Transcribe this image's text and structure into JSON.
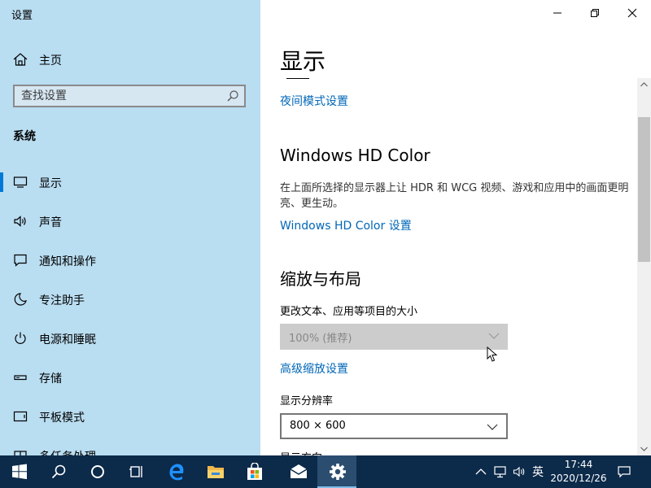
{
  "sidebar": {
    "app_title": "设置",
    "home_label": "主页",
    "search_placeholder": "查找设置",
    "section_label": "系统",
    "items": [
      {
        "label": "显示",
        "icon": "monitor-icon",
        "selected": true
      },
      {
        "label": "声音",
        "icon": "speaker-icon"
      },
      {
        "label": "通知和操作",
        "icon": "notification-icon"
      },
      {
        "label": "专注助手",
        "icon": "moon-icon"
      },
      {
        "label": "电源和睡眠",
        "icon": "power-icon"
      },
      {
        "label": "存储",
        "icon": "storage-icon"
      },
      {
        "label": "平板模式",
        "icon": "tablet-icon"
      },
      {
        "label": "多任务处理",
        "icon": "multitask-icon"
      }
    ]
  },
  "main": {
    "title": "显示",
    "night_light_link": "夜间模式设置",
    "hdr": {
      "heading": "Windows HD Color",
      "description": "在上面所选择的显示器上让 HDR 和 WCG 视频、游戏和应用中的画面更明亮、更生动。",
      "link": "Windows HD Color 设置"
    },
    "scale": {
      "heading": "缩放与布局",
      "text_size_label": "更改文本、应用等项目的大小",
      "text_size_value": "100% (推荐)",
      "advanced_link": "高级缩放设置",
      "resolution_label": "显示分辨率",
      "resolution_value": "800 × 600",
      "orientation_label": "显示方向"
    }
  },
  "window_controls": [
    "minimize-icon",
    "restore-icon",
    "close-icon"
  ],
  "taskbar": {
    "apps": [
      "windows-start-icon",
      "search-icon",
      "cortana-icon",
      "task-view-icon",
      "edge-icon",
      "file-explorer-icon",
      "store-icon",
      "mail-icon",
      "settings-icon"
    ],
    "ime": "英",
    "time": "17:44",
    "date": "2020/12/26"
  },
  "colors": {
    "sidebar_bg": "#b9ddf1",
    "accent": "#0078d7",
    "link": "#0067b8",
    "taskbar": "#0c2a4a"
  }
}
